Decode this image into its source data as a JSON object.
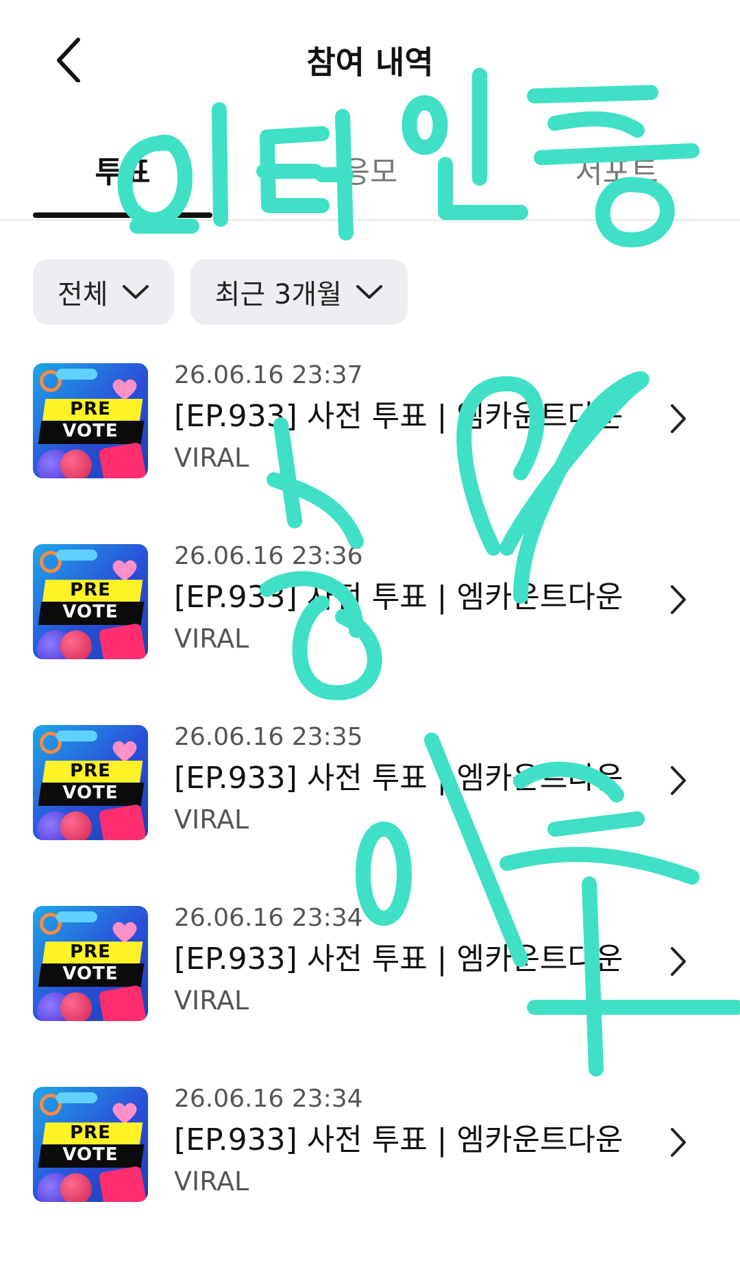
{
  "header": {
    "title": "참여 내역"
  },
  "tabs": [
    {
      "label": "투표"
    },
    {
      "label": "응모"
    },
    {
      "label": "서포트"
    }
  ],
  "filters": [
    {
      "label": "전체"
    },
    {
      "label": "최근 3개월"
    }
  ],
  "thumbnail": {
    "line1": "PRE",
    "line2": "VOTE"
  },
  "items": [
    {
      "date": "26.06.16 23:37",
      "title": "[EP.933] 사전 투표 | 엠카운트다운",
      "category": "VIRAL"
    },
    {
      "date": "26.06.16 23:36",
      "title": "[EP.933] 사전 투표 | 엠카운트다운",
      "category": "VIRAL"
    },
    {
      "date": "26.06.16 23:35",
      "title": "[EP.933] 사전 투표 | 엠카운트다운",
      "category": "VIRAL"
    },
    {
      "date": "26.06.16 23:34",
      "title": "[EP.933] 사전 투표 | 엠카운트다운",
      "category": "VIRAL"
    },
    {
      "date": "26.06.16 23:34",
      "title": "[EP.933] 사전 투표 | 엠카운트다운",
      "category": "VIRAL"
    }
  ],
  "handwriting": {
    "color": "#3fe0c5",
    "description": "handwritten scribble overlay"
  },
  "colors": {
    "active_tab": "#111111",
    "chip_bg": "#eceef1",
    "annotation": "#3fe0c5"
  }
}
